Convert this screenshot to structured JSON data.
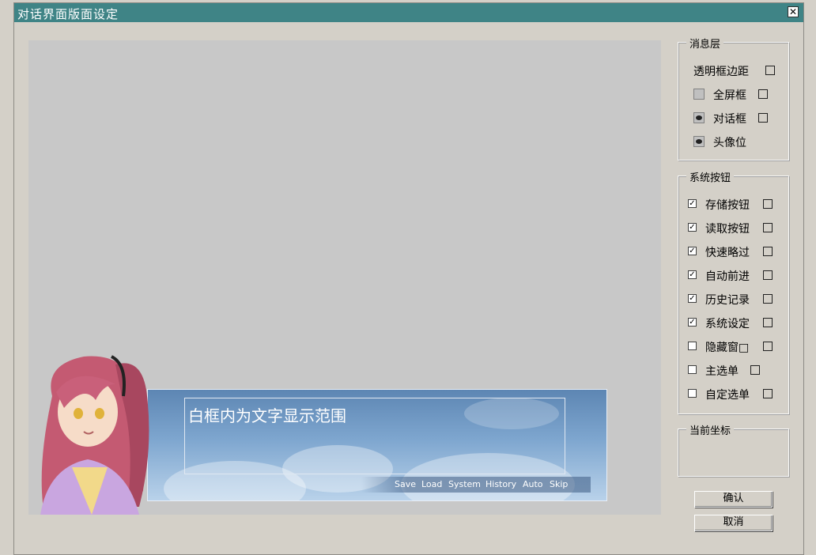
{
  "window": {
    "title": "对话界面版面设定",
    "close_glyph": "✕"
  },
  "preview": {
    "sample_text": "白框内为文字显示范围",
    "system_buttons": [
      "Save",
      "Load",
      "System",
      "History",
      "Auto",
      "Skip"
    ]
  },
  "message_layer": {
    "legend": "消息层",
    "items": [
      {
        "label": "透明框边距",
        "visible_toggle": "none"
      },
      {
        "label": "全屏框",
        "visible_toggle": "off"
      },
      {
        "label": "对话框",
        "visible_toggle": "on"
      },
      {
        "label": "头像位",
        "visible_toggle": "on"
      }
    ]
  },
  "system_buttons": {
    "legend": "系统按钮",
    "items": [
      {
        "label": "存储按钮",
        "checked": true
      },
      {
        "label": "读取按钮",
        "checked": true
      },
      {
        "label": "快速略过",
        "checked": true
      },
      {
        "label": "自动前进",
        "checked": true
      },
      {
        "label": "历史记录",
        "checked": true
      },
      {
        "label": "系统设定",
        "checked": true
      },
      {
        "label": "隐藏窗□",
        "checked": false
      },
      {
        "label": "主选单",
        "checked": false
      },
      {
        "label": "自定选单",
        "checked": false
      }
    ]
  },
  "coordinates": {
    "legend": "当前坐标"
  },
  "buttons": {
    "confirm": "确认",
    "cancel": "取消"
  },
  "colors": {
    "titlebar": "#3f8486",
    "dialog_bg": "#d4d0c8",
    "preview_bg": "#c8c8c8"
  }
}
